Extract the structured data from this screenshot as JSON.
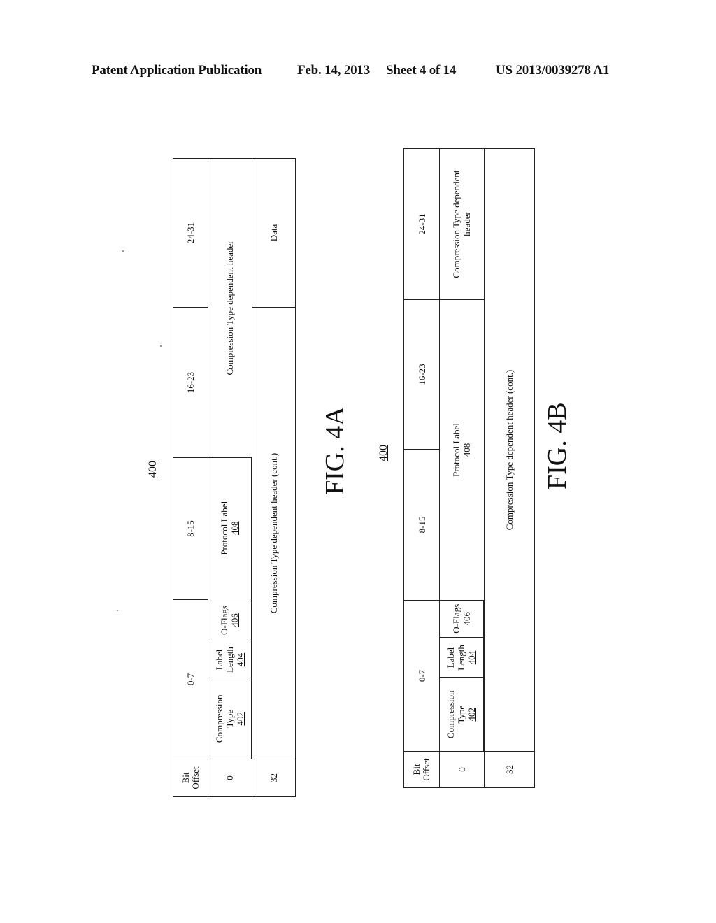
{
  "header": {
    "publication": "Patent Application Publication",
    "date": "Feb. 14, 2013",
    "sheet": "Sheet 4 of 14",
    "number": "US 2013/0039278 A1"
  },
  "figures": [
    {
      "id": "fig4a",
      "caption": "FIG. 4A",
      "ref": "400",
      "table": {
        "column_headers": [
          "Bit Offset",
          "0-7",
          "8-15",
          "16-23",
          "24-31"
        ],
        "row0": {
          "offset": "0",
          "compression_type": {
            "label": "Compression Type",
            "ref": "402"
          },
          "label_length": {
            "label": "Label Length",
            "ref": "404"
          },
          "o_flags": {
            "label": "O-Flags",
            "ref": "406"
          },
          "protocol_label": {
            "label": "Protocol Label",
            "ref": "408"
          },
          "ctdh": "Compression Type dependent header"
        },
        "row32": {
          "offset": "32",
          "ctdh_cont": "Compression Type dependent header (cont.)",
          "data": "Data"
        }
      }
    },
    {
      "id": "fig4b",
      "caption": "FIG. 4B",
      "ref": "400",
      "table": {
        "column_headers": [
          "Bit Offset",
          "0-7",
          "8-15",
          "16-23",
          "24-31"
        ],
        "row0": {
          "offset": "0",
          "compression_type": {
            "label": "Compression Type",
            "ref": "402"
          },
          "label_length": {
            "label": "Label Length",
            "ref": "404"
          },
          "o_flags": {
            "label": "O-Flags",
            "ref": "406"
          },
          "protocol_label": {
            "label": "Protocol Label",
            "ref": "408"
          },
          "ctdh": "Compression Type dependent header"
        },
        "row32": {
          "offset": "32",
          "ctdh_cont": "Compression Type dependent header (cont.)"
        }
      }
    }
  ]
}
